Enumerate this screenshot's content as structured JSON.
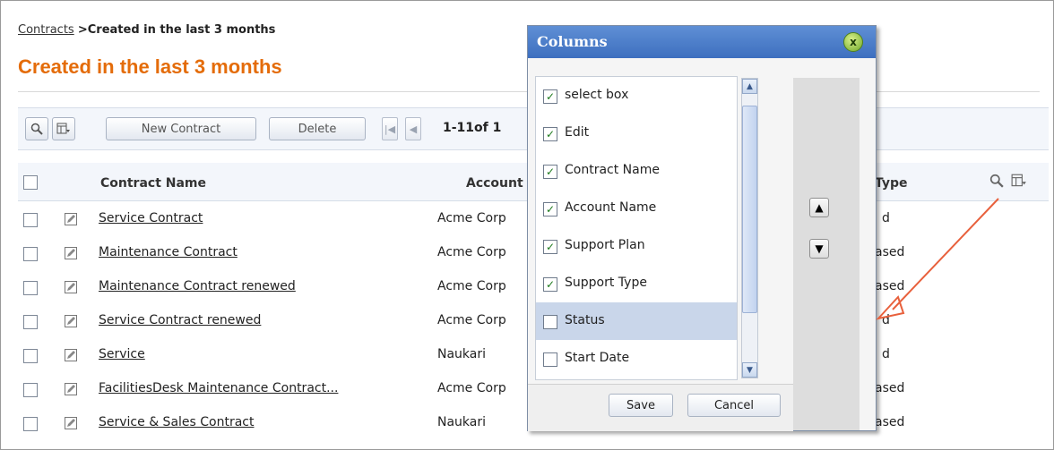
{
  "breadcrumb": {
    "link": "Contracts",
    "separator": ">",
    "current": "Created in the last 3 months"
  },
  "page": {
    "title": "Created in the last 3 months"
  },
  "toolbar": {
    "new_contract_label": "New Contract",
    "delete_label": "Delete",
    "pager_text": "1-11of 1"
  },
  "table": {
    "columns": {
      "name": "Contract Name",
      "account": "Account",
      "type": "Type"
    },
    "rows": [
      {
        "name": "Service Contract ",
        "account": "Acme Corp",
        "type": "d"
      },
      {
        "name": "Maintenance Contract ",
        "account": "Acme Corp",
        "type": "ased"
      },
      {
        "name": "Maintenance Contract renewed ",
        "account": "Acme Corp",
        "type": "ased"
      },
      {
        "name": "Service Contract renewed ",
        "account": "Acme Corp",
        "type": "d"
      },
      {
        "name": "Service ",
        "account": "Naukari",
        "type": "d"
      },
      {
        "name": "FacilitiesDesk Maintenance Contract...",
        "account": "Acme Corp",
        "type": "ased"
      },
      {
        "name": "Service & Sales Contract ",
        "account": "Naukari",
        "type": "ased"
      }
    ]
  },
  "dialog": {
    "title": "Columns",
    "close_label": "x",
    "options": [
      {
        "label": "select box",
        "checked": true
      },
      {
        "label": "Edit",
        "checked": true
      },
      {
        "label": "Contract Name",
        "checked": true
      },
      {
        "label": "Account Name",
        "checked": true
      },
      {
        "label": "Support Plan",
        "checked": true
      },
      {
        "label": "Support Type",
        "checked": true
      },
      {
        "label": "Status",
        "checked": false,
        "highlighted": true
      },
      {
        "label": "Start Date",
        "checked": false
      }
    ],
    "save_label": "Save",
    "cancel_label": "Cancel"
  },
  "colors": {
    "title": "#e46c0a",
    "dialog_header": "#4a7ccb",
    "annotation_arrow": "#e8603c"
  }
}
